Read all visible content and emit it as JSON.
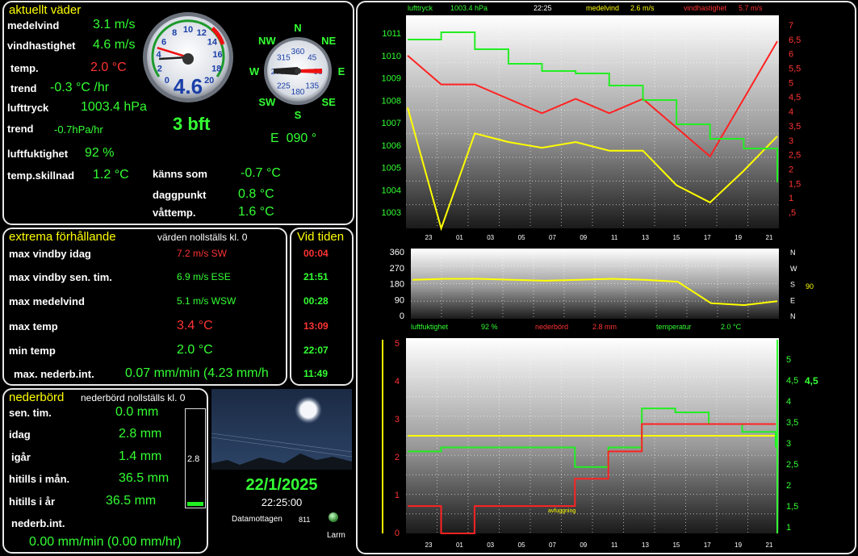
{
  "current": {
    "title": "aktuellt väder",
    "rows": [
      {
        "label": "medelvind",
        "value": "3.1 m/s",
        "color": "#33ff33"
      },
      {
        "label": "vindhastighet",
        "value": "4.6 m/s",
        "color": "#33ff33"
      },
      {
        "label": "temp.",
        "value": "2.0 °C",
        "color": "#ff3333"
      },
      {
        "label": "trend",
        "value": "-0.3 °C /hr",
        "color": "#33ff33"
      },
      {
        "label": "lufttryck",
        "value": "1003.4 hPa",
        "color": "#33ff33"
      },
      {
        "label": "trend",
        "value": "-0.7hPa/hr",
        "color": "#33ff33"
      },
      {
        "label": "luftfuktighet",
        "value": "92 %",
        "color": "#33ff33"
      },
      {
        "label": "temp.skillnad",
        "value": "1.2 °C",
        "color": "#33ff33"
      }
    ],
    "extra": [
      {
        "label": "känns som",
        "value": "-0.7 °C"
      },
      {
        "label": "daggpunkt",
        "value": "0.8 °C"
      },
      {
        "label": "våttemp.",
        "value": "1.6 °C"
      }
    ],
    "beaufort": "3 bft",
    "direction": "E  090 °",
    "gauge_speed": {
      "value": "4.6",
      "ticks": [
        "0",
        "2",
        "4",
        "6",
        "8",
        "10",
        "12",
        "14",
        "16",
        "18",
        "20"
      ],
      "speed": 4.6,
      "needle_speed": 3.1
    },
    "compass": {
      "labels": [
        "N",
        "NE",
        "E",
        "SE",
        "S",
        "SW",
        "W",
        "NW"
      ],
      "ring": [
        "360",
        "45",
        "90",
        "135",
        "180",
        "225",
        "270",
        "315"
      ],
      "value": "90"
    }
  },
  "extremes": {
    "title": "extrema förhållande",
    "reset_note": "värden nollställs kl. 0",
    "time_title": "Vid tiden",
    "rows": [
      {
        "label": "max vindby idag",
        "value": "7.2 m/s SW",
        "time": "00:04",
        "color": "#ff3333",
        "timecolor": "#ff3333"
      },
      {
        "label": "max vindby sen. tim.",
        "value": "6.9 m/s ESE",
        "time": "21:51",
        "color": "#33ff33",
        "timecolor": "#33ff33"
      },
      {
        "label": "max medelvind",
        "value": "5.1 m/s WSW",
        "time": "00:28",
        "color": "#33ff33",
        "timecolor": "#33ff33"
      },
      {
        "label": "max temp",
        "value": "3.4 °C",
        "time": "13:09",
        "color": "#ff3333",
        "timecolor": "#ff3333"
      },
      {
        "label": "min temp",
        "value": "2.0 °C",
        "time": "22:07",
        "color": "#33ff33",
        "timecolor": "#33ff33"
      },
      {
        "label": "max. nederb.int.",
        "value": "0.07 mm/min (4.23 mm/h",
        "time": "11:49",
        "color": "#33ff33",
        "timecolor": "#33ff33"
      }
    ]
  },
  "rain": {
    "title": "nederbörd",
    "reset_note": "nederbörd nollställs kl. 0",
    "rows": [
      {
        "label": "sen. tim.",
        "value": "0.0 mm"
      },
      {
        "label": "idag",
        "value": "2.8 mm"
      },
      {
        "label": "igår",
        "value": "1.4 mm"
      },
      {
        "label": "hitills i mån.",
        "value": "36.5 mm"
      },
      {
        "label": "hitills i år",
        "value": "36.5 mm"
      }
    ],
    "int_label": "nederb.int.",
    "int_value": "0.00 mm/min (0.00 mm/hr)",
    "bar_value": "2.8",
    "bar_fraction": 0.04
  },
  "status": {
    "date": "22/1/2025",
    "time": "22:25:00",
    "received_label": "Datamottagen",
    "received_count": "811",
    "alarm_label": "Larm"
  },
  "graph_top": {
    "legend": [
      {
        "label": "lufttryck",
        "value": "1003.4 hPa",
        "color": "#33ff33"
      },
      {
        "label": "22:25",
        "value": "",
        "color": "#ffffff"
      },
      {
        "label": "medelvind",
        "value": "2.6 m/s",
        "color": "#ffff00"
      },
      {
        "label": "vindhastighet",
        "value": "5.7 m/s",
        "color": "#ff3333"
      }
    ],
    "left_ticks": [
      "1011",
      "1010",
      "1009",
      "1008",
      "1007",
      "1006",
      "1005",
      "1004",
      "1003"
    ],
    "right_ticks": [
      "7",
      "6,5",
      "6",
      "5,5",
      "5",
      "4,5",
      "4",
      "3,5",
      "3",
      "2,5",
      "2",
      "1,5",
      "1",
      ",5"
    ],
    "x_ticks": [
      "23",
      "01",
      "03",
      "05",
      "07",
      "09",
      "11",
      "13",
      "15",
      "17",
      "19",
      "21"
    ]
  },
  "graph_dir": {
    "left_ticks": [
      "360",
      "270",
      "180",
      "90",
      "0"
    ],
    "right_ticks": [
      "N",
      "W",
      "S",
      "E",
      "N"
    ],
    "right_value": "90"
  },
  "graph_bottom": {
    "legend": [
      {
        "label": "luftfuktighet",
        "value": "92 %",
        "color": "#33ff33"
      },
      {
        "label": "nederbörd",
        "value": "2.8 mm",
        "color": "#ff3333"
      },
      {
        "label": "temperatur",
        "value": "2.0 °C",
        "color": "#33ff33"
      }
    ],
    "left_ticks": [
      "5",
      "4",
      "3",
      "2",
      "1",
      "0"
    ],
    "right_ticks": [
      "5",
      "4,5",
      "4",
      "3,5",
      "3",
      "2,5",
      "2",
      "1,5",
      "1"
    ],
    "right_current": "4,5",
    "x_ticks": [
      "23",
      "01",
      "03",
      "05",
      "07",
      "09",
      "11",
      "13",
      "15",
      "17",
      "19",
      "21"
    ],
    "annotation": "avfuggning"
  },
  "chart_data": [
    {
      "type": "line",
      "x": [
        "23",
        "01",
        "03",
        "05",
        "07",
        "09",
        "11",
        "13",
        "15",
        "17",
        "19",
        "21"
      ],
      "series": [
        {
          "name": "lufttryck",
          "values": [
            1010.3,
            1010.6,
            1009.9,
            1009.3,
            1009.0,
            1008.9,
            1008.4,
            1007.8,
            1006.8,
            1006.2,
            1005.8,
            1004.4
          ]
        },
        {
          "name": "medelvind",
          "values": [
            4.2,
            0.0,
            3.3,
            3.0,
            2.8,
            3.0,
            2.7,
            2.7,
            1.5,
            0.9,
            2.0,
            3.2
          ]
        },
        {
          "name": "vindhastighet",
          "values": [
            6.0,
            5.0,
            5.0,
            4.5,
            4.0,
            4.5,
            4.0,
            4.5,
            3.5,
            2.5,
            4.5,
            6.5
          ]
        }
      ],
      "ylim": [
        1002.5,
        1011.3
      ]
    },
    {
      "type": "line",
      "x": [
        "23",
        "01",
        "03",
        "05",
        "07",
        "09",
        "11",
        "13",
        "15",
        "17",
        "19",
        "21"
      ],
      "series": [
        {
          "name": "",
          "values": [
            200,
            205,
            205,
            200,
            195,
            200,
            205,
            200,
            190,
            80,
            70,
            90
          ]
        }
      ],
      "ylim": [
        0,
        360
      ]
    },
    {
      "type": "line",
      "x": [
        "23",
        "01",
        "03",
        "05",
        "07",
        "09",
        "11",
        "13",
        "15",
        "17",
        "19",
        "21"
      ],
      "series": [
        {
          "name": "luftfuktighet",
          "values": [
            2.1,
            2.2,
            2.2,
            2.2,
            2.2,
            1.7,
            2.2,
            3.2,
            3.1,
            2.8,
            2.6,
            2.2
          ]
        },
        {
          "name": "nederbörd",
          "values": [
            0.7,
            0.0,
            0.7,
            0.7,
            0.7,
            1.4,
            2.1,
            2.8,
            2.8,
            2.8,
            2.8,
            2.8
          ]
        },
        {
          "name": "temperatur",
          "values": [
            2.5,
            2.5,
            2.5,
            2.5,
            2.5,
            2.5,
            2.5,
            2.5,
            2.5,
            2.5,
            2.5,
            2.5
          ]
        }
      ],
      "ylim": [
        0,
        5
      ]
    }
  ]
}
